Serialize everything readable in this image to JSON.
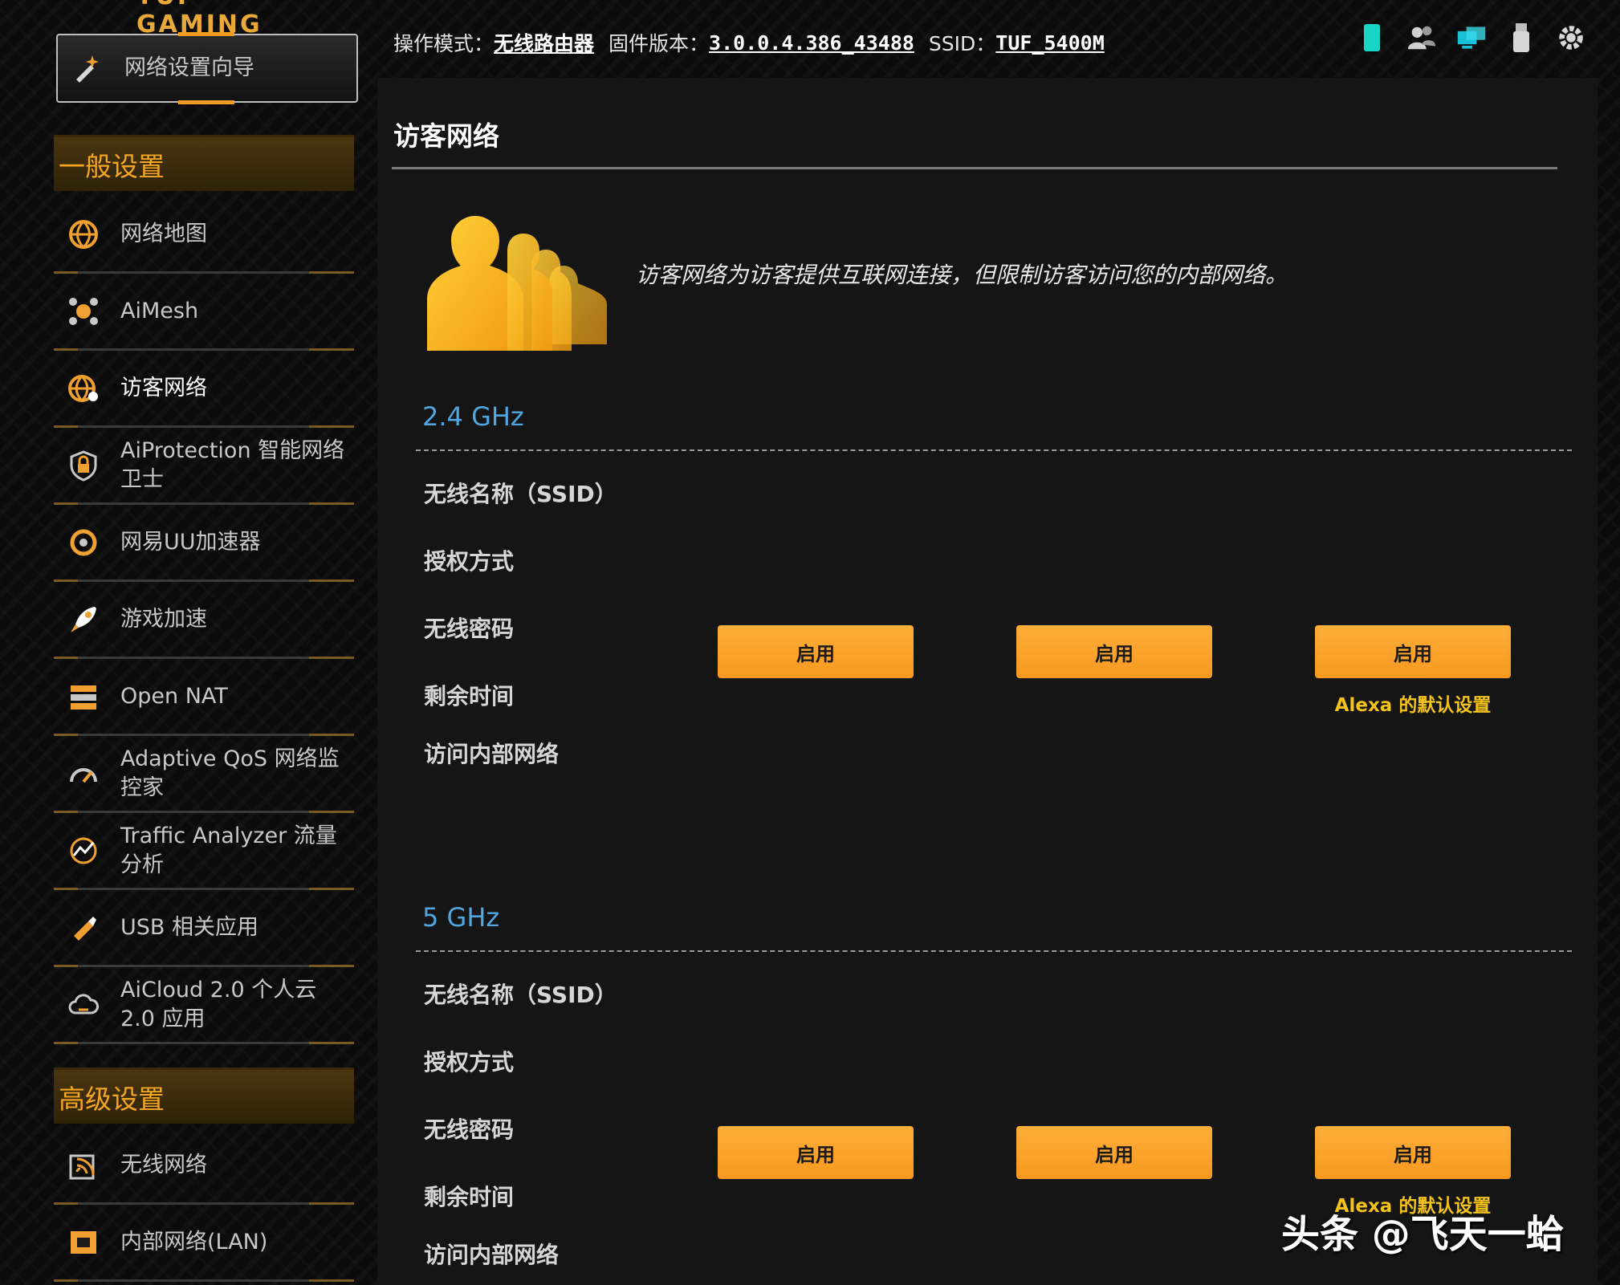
{
  "brand": "TUF GAMING",
  "topbar": {
    "mode_label": "操作模式：",
    "mode_value": "无线路由器",
    "fw_label": "固件版本：",
    "fw_value": "3.0.0.4.386_43488",
    "ssid_label": "SSID：",
    "ssid_value": "TUF_5400M"
  },
  "status_icons": [
    "mobile-icon",
    "users-icon",
    "network-icon",
    "usb-icon",
    "settings-gear-icon"
  ],
  "sidebar": {
    "wizard_label": "网络设置向导",
    "general_header": "一般设置",
    "general_items": [
      {
        "label": "网络地图",
        "icon": "globe-icon"
      },
      {
        "label": "AiMesh",
        "icon": "mesh-icon"
      },
      {
        "label": "访客网络",
        "icon": "guest-globe-icon",
        "active": true
      },
      {
        "label": "AiProtection 智能网络卫士",
        "icon": "lock-shield-icon"
      },
      {
        "label": "网易UU加速器",
        "icon": "uu-booster-icon"
      },
      {
        "label": "游戏加速",
        "icon": "rocket-icon"
      },
      {
        "label": "Open NAT",
        "icon": "nat-icon"
      },
      {
        "label": "Adaptive QoS 网络监控家",
        "icon": "speedometer-icon"
      },
      {
        "label": "Traffic Analyzer 流量分析",
        "icon": "traffic-analyzer-icon"
      },
      {
        "label": "USB 相关应用",
        "icon": "usb-app-icon"
      },
      {
        "label": "AiCloud 2.0 个人云 2.0 应用",
        "icon": "cloud-icon"
      }
    ],
    "advanced_header": "高级设置",
    "advanced_items": [
      {
        "label": "无线网络",
        "icon": "wireless-icon"
      },
      {
        "label": "内部网络(LAN)",
        "icon": "lan-icon"
      }
    ]
  },
  "main": {
    "title": "访客网络",
    "description": "访客网络为访客提供互联网连接，但限制访客访问您的内部网络。",
    "bands": [
      {
        "name": "2.4 GHz",
        "row_labels": [
          "无线名称（SSID）",
          "授权方式",
          "无线密码",
          "剩余时间",
          "访问内部网络"
        ],
        "buttons": [
          "启用",
          "启用",
          "启用"
        ],
        "alexa_note": "Alexa 的默认设置"
      },
      {
        "name": "5 GHz",
        "row_labels": [
          "无线名称（SSID）",
          "授权方式",
          "无线密码",
          "剩余时间",
          "访问内部网络"
        ],
        "buttons": [
          "启用",
          "启用",
          "启用"
        ],
        "alexa_note": "Alexa 的默认设置"
      }
    ]
  },
  "watermark": "头条 @飞天一蛤",
  "colors": {
    "accent": "#f7991f",
    "band_title": "#4fa6e0",
    "alexa": "#f3c21b",
    "section_header": "#f5a623"
  }
}
